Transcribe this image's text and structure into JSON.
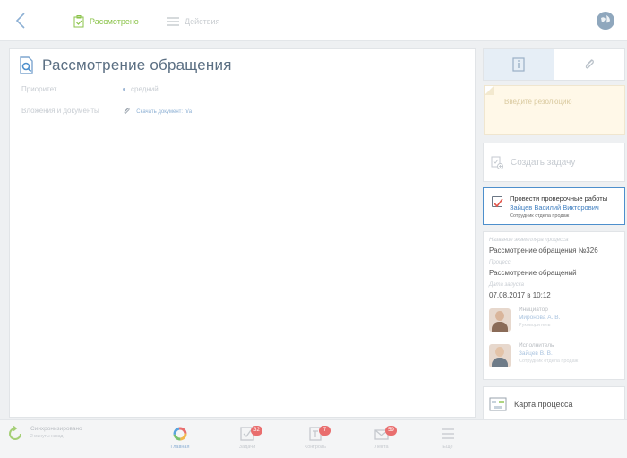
{
  "topbar": {
    "status_label": "Рассмотрено",
    "actions_label": "Действия"
  },
  "main": {
    "title": "Рассмотрение обращения",
    "priority_label": "Приоритет",
    "priority_value": "средний",
    "attachments_label": "Вложения и документы",
    "attachment_link": "Скачать документ: n/a"
  },
  "resolution": {
    "placeholder": "Введите резолюцию"
  },
  "create_task": {
    "label": "Создать задачу"
  },
  "task": {
    "title": "Провести проверочные работы",
    "assignee": "Зайцев Василий Викторович",
    "role": "Сотрудник отдела продаж"
  },
  "process": {
    "instance_label": "Название экземпляра процесса",
    "instance_value": "Рассмотрение обращения №326",
    "process_label": "Процесс",
    "process_value": "Рассмотрение обращений",
    "start_label": "Дата запуска",
    "start_value": "07.08.2017 в 10:12",
    "initiator": {
      "role": "Инициатор",
      "name": "Миронова А. В.",
      "position": "Руководитель"
    },
    "executor": {
      "role": "Исполнитель",
      "name": "Зайцев В. В.",
      "position": "Сотрудник отдела продаж"
    }
  },
  "process_map": {
    "label": "Карта процесса"
  },
  "bottom": {
    "sync_title": "Синхронизировано",
    "sync_time": "2 минуты назад",
    "nav": [
      {
        "label": "Главная"
      },
      {
        "label": "Задачи",
        "badge": "32"
      },
      {
        "label": "Контроль",
        "badge": "7"
      },
      {
        "label": "Лента",
        "badge": "59"
      },
      {
        "label": "Ещё"
      }
    ]
  },
  "colors": {
    "accent": "#4d8fcc",
    "status_green": "#8bc34a",
    "badge_red": "#e96e6e",
    "note_bg": "#fff8e8"
  }
}
